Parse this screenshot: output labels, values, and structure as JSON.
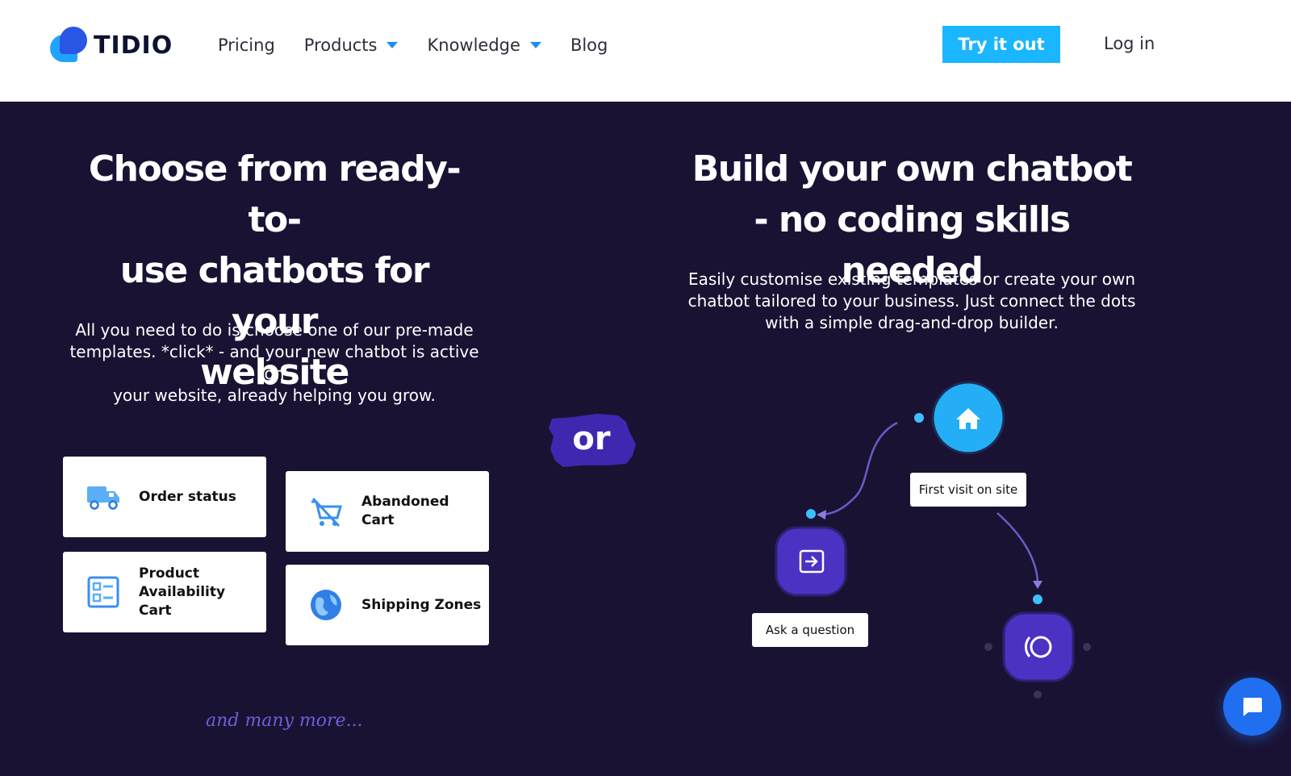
{
  "header": {
    "logo_text": "TIDIO",
    "nav": [
      {
        "label": "Pricing",
        "dropdown": false
      },
      {
        "label": "Products",
        "dropdown": true
      },
      {
        "label": "Knowledge",
        "dropdown": true
      },
      {
        "label": "Blog",
        "dropdown": false
      }
    ],
    "cta_label": "Try it out",
    "login_label": "Log in"
  },
  "hero": {
    "left_heading_lines": [
      "Choose from ready-to-",
      "use chatbots for your",
      "website"
    ],
    "left_paragraph_lines": [
      "All you need to do is choose one of our pre-made",
      "templates. *click* - and your new chatbot is active on",
      "your website, already helping you grow."
    ],
    "right_heading_lines": [
      "Build your own chatbot",
      "- no coding skills needed"
    ],
    "right_paragraph_lines": [
      "Easily customise existing templates or create your own",
      "chatbot tailored to your business. Just connect the dots",
      "with a simple drag-and-drop builder."
    ],
    "or_label": "or",
    "templates": [
      {
        "label_lines": [
          "Order status"
        ],
        "icon": "truck-icon"
      },
      {
        "label_lines": [
          "Abandoned",
          "Cart"
        ],
        "icon": "cart-cancel-icon"
      },
      {
        "label_lines": [
          "Product",
          "Availability",
          "Cart"
        ],
        "icon": "checklist-icon"
      },
      {
        "label_lines": [
          "Shipping Zones"
        ],
        "icon": "globe-icon"
      }
    ],
    "more_label": "and many more...",
    "flow": {
      "first_visit_label": "First visit on site",
      "ask_question_label": "Ask a question",
      "node_icons": [
        "home-icon",
        "enter-icon",
        "bot-icon"
      ]
    }
  },
  "colors": {
    "hero_bg": "#1a1233",
    "accent_cyan": "#1ab6ff",
    "node_purple": "#4b32c3",
    "brush_purple": "#4027b0",
    "chat_fab": "#1f6ff0"
  },
  "widgets": {
    "chat_icon": "chat-bubble-icon"
  }
}
